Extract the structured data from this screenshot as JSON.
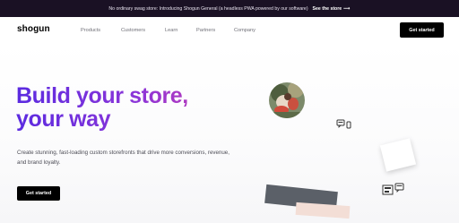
{
  "announcement": {
    "message": "No ordinary swag store: Introducing Shogun General (a headless PWA powered by our software)",
    "link_label": "See the store",
    "arrow_icon": "arrow-right-icon"
  },
  "nav": {
    "logo": "shogun",
    "links": [
      "Products",
      "Customers",
      "Learn",
      "Partners",
      "Company"
    ],
    "cta_label": "Get started"
  },
  "hero": {
    "headline_line1": "Build your store,",
    "headline_line2": "your way",
    "subtitle": "Create stunning, fast-loading custom storefronts that drive more conversions, revenue, and brand loyalty.",
    "cta_label": "Get started"
  },
  "colors": {
    "announcement_bg": "#1a1124",
    "headline_gradient_start": "#5b2be0",
    "headline_gradient_end": "#d23ea8",
    "button_bg": "#000000"
  },
  "decorations": {
    "photo": "hero-photo",
    "icons": [
      "chat-bubbles-icon",
      "frame-icons-icon"
    ]
  }
}
